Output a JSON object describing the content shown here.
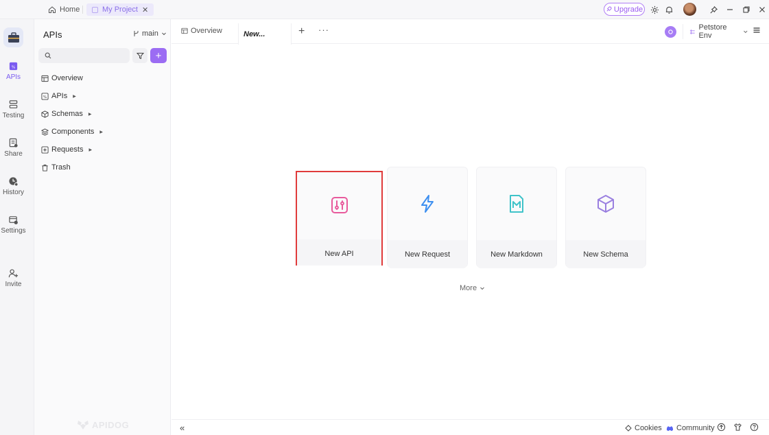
{
  "titlebar": {
    "home_label": "Home",
    "project_tab_label": "My Project",
    "upgrade_label": "Upgrade"
  },
  "rail": {
    "items": [
      {
        "label": "APIs",
        "icon": "api-icon",
        "active": true
      },
      {
        "label": "Testing",
        "icon": "testing-icon"
      },
      {
        "label": "Share",
        "icon": "share-icon"
      },
      {
        "label": "History",
        "icon": "history-icon"
      },
      {
        "label": "Settings",
        "icon": "settings-icon"
      },
      {
        "label": "Invite",
        "icon": "invite-icon"
      }
    ]
  },
  "sidebar": {
    "title": "APIs",
    "branch": "main",
    "search_placeholder": "",
    "add_label": "+",
    "tree": [
      {
        "label": "Overview",
        "icon": "overview-icon",
        "expandable": false
      },
      {
        "label": "APIs",
        "icon": "api-icon",
        "expandable": true
      },
      {
        "label": "Schemas",
        "icon": "schema-icon",
        "expandable": true
      },
      {
        "label": "Components",
        "icon": "components-icon",
        "expandable": true
      },
      {
        "label": "Requests",
        "icon": "requests-icon",
        "expandable": true
      },
      {
        "label": "Trash",
        "icon": "trash-icon",
        "expandable": false
      }
    ],
    "watermark": "APIDOG"
  },
  "tabs": {
    "overview_label": "Overview",
    "active_label": "New...",
    "add_label": "+",
    "more_label": "···"
  },
  "env": {
    "selected": "Petstore Env"
  },
  "cards": [
    {
      "label": "New API",
      "icon": "api-icon",
      "color": "#e85a9c",
      "highlighted": true
    },
    {
      "label": "New Request",
      "icon": "lightning-icon",
      "color": "#3d8ff0"
    },
    {
      "label": "New Markdown",
      "icon": "markdown-icon",
      "color": "#3fc3c9"
    },
    {
      "label": "New Schema",
      "icon": "cube-icon",
      "color": "#9a7fe0"
    }
  ],
  "more_label": "More",
  "bottombar": {
    "cookies_label": "Cookies",
    "community_label": "Community"
  },
  "colors": {
    "accent": "#9b6cf3",
    "highlight": "#e03a3a"
  }
}
